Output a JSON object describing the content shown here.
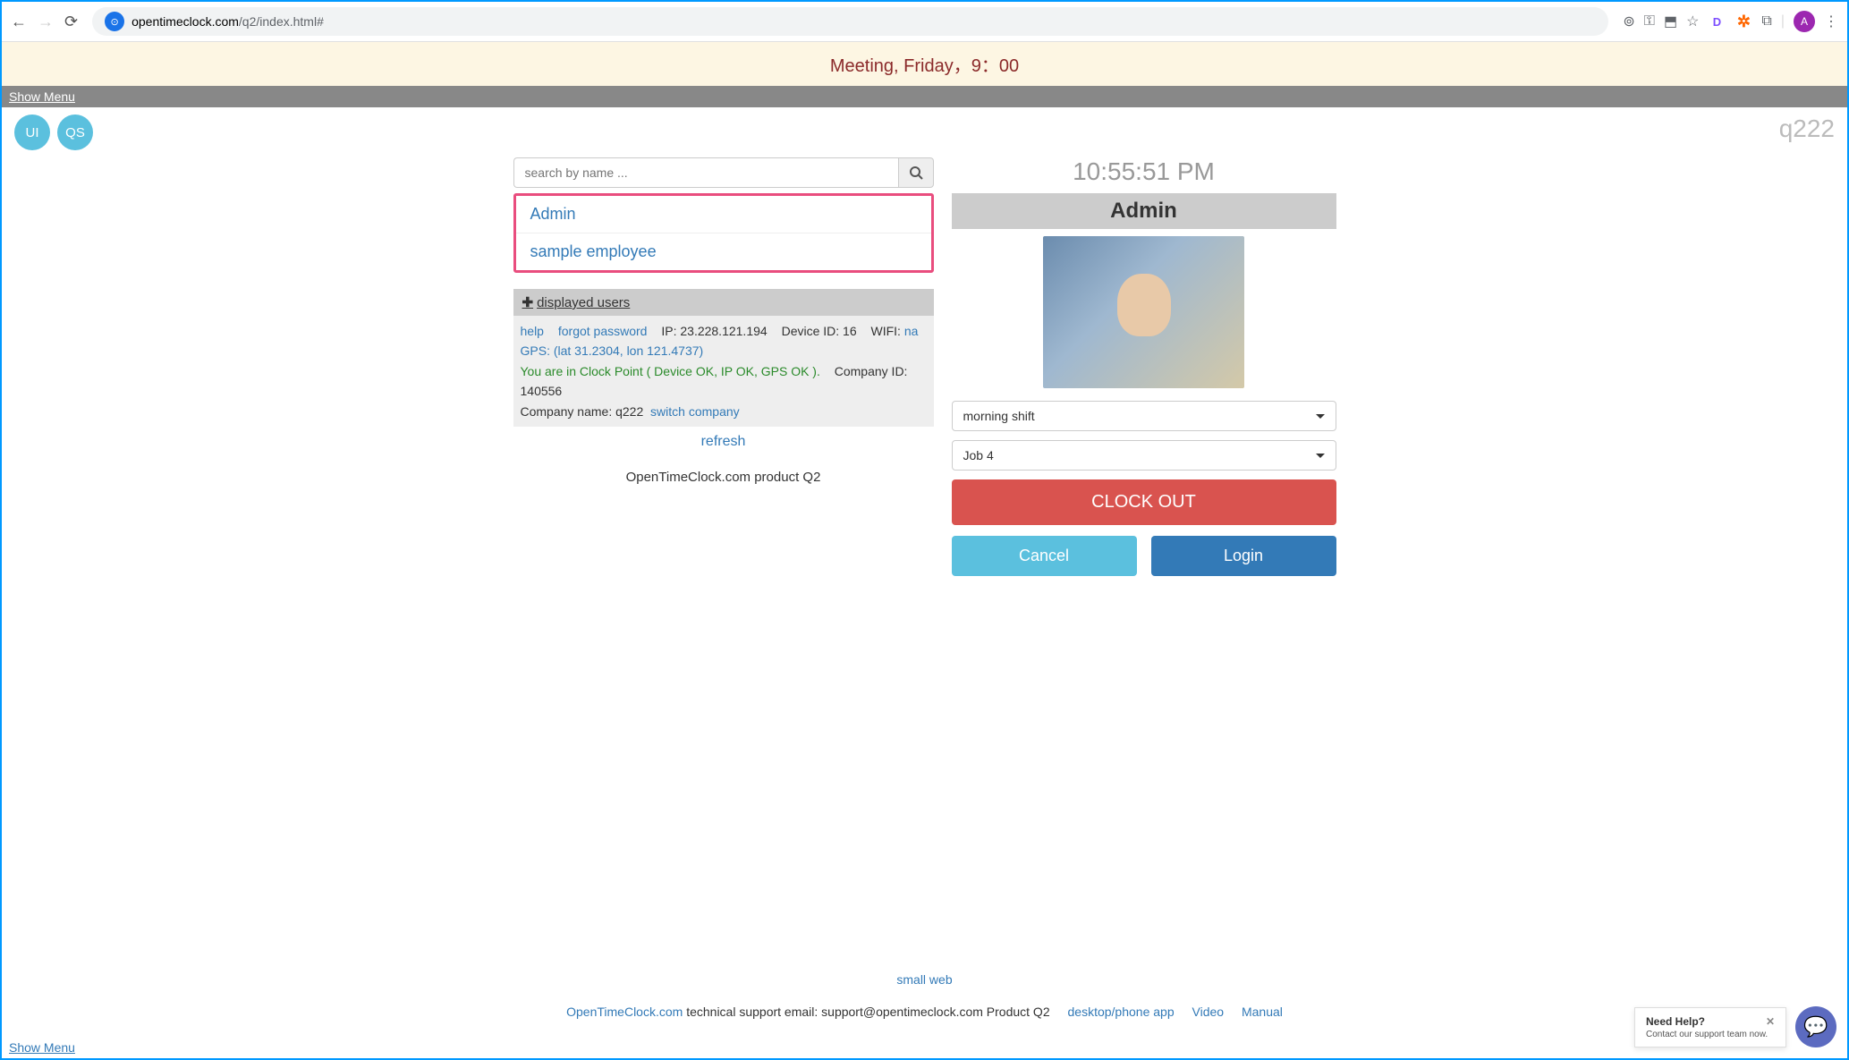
{
  "browser": {
    "url_domain": "opentimeclock.com",
    "url_path": "/q2/index.html#",
    "profile_initial": "A",
    "ext_d": "D"
  },
  "banner": {
    "text": "Meeting, Friday，9：00"
  },
  "menu": {
    "show_top": "Show Menu",
    "show_bottom": "Show Menu"
  },
  "avatars": [
    "UI",
    "QS"
  ],
  "company_code": "q222",
  "search": {
    "placeholder": "search by name ..."
  },
  "users": [
    "Admin",
    "sample employee"
  ],
  "displayed_users_label": "displayed users",
  "info": {
    "help": "help",
    "forgot": "forgot password",
    "ip_label": "IP: 23.228.121.194",
    "device_label": "Device ID: 16",
    "wifi_label": "WIFI:",
    "wifi_value": "na",
    "gps_link": "GPS: (lat 31.2304, lon 121.4737)",
    "clock_point": "You are in Clock Point ( Device OK, IP OK, GPS OK ).",
    "company_id": "Company ID: 140556",
    "company_name": "Company name: q222",
    "switch_company": "switch company"
  },
  "refresh": "refresh",
  "product_line": "OpenTimeClock.com product Q2",
  "right": {
    "clock": "10:55:51 PM",
    "selected_user": "Admin",
    "shift": "morning shift",
    "job": "Job 4"
  },
  "buttons": {
    "clock_out": "CLOCK OUT",
    "cancel": "Cancel",
    "login": "Login"
  },
  "footer": {
    "small_web": "small web",
    "otc": "OpenTimeClock.com",
    "support": " technical support email: support@opentimeclock.com Product Q2",
    "desktop": "desktop/phone app",
    "video": "Video",
    "manual": "Manual"
  },
  "help_widget": {
    "title": "Need Help?",
    "sub": "Contact our support team now."
  }
}
